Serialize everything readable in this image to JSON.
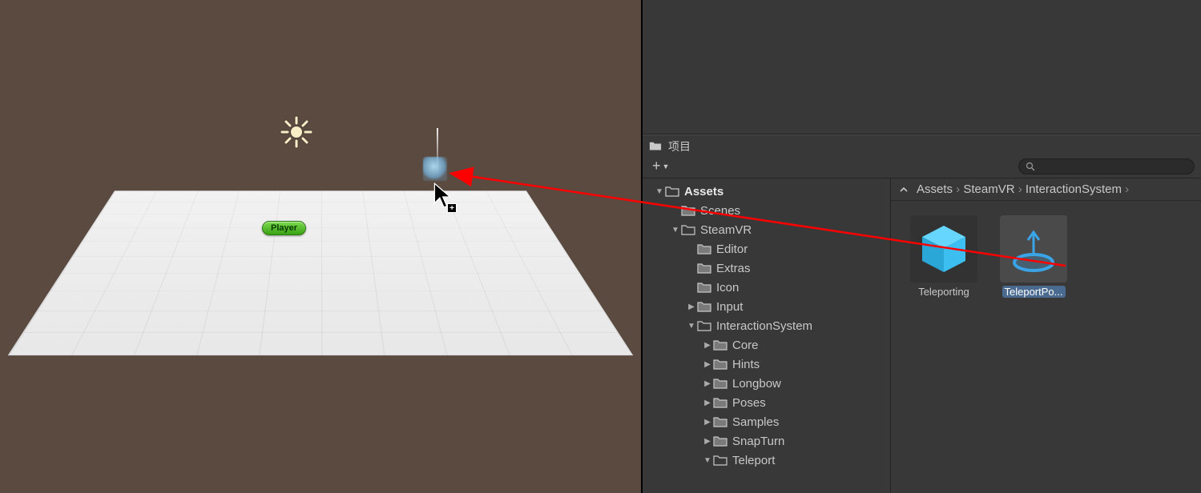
{
  "colors": {
    "panel_bg": "#383838",
    "accent_prefab": "#49c2f1",
    "player_pill": "#55c22d",
    "arrow": "#ff0000"
  },
  "scene": {
    "player_label": "Player"
  },
  "project": {
    "panel_title": "项目",
    "search_placeholder": "",
    "breadcrumb": [
      "Assets",
      "SteamVR",
      "InteractionSystem"
    ],
    "tree": {
      "root": "Assets",
      "nodes": [
        {
          "name": "Scenes",
          "depth": 1,
          "expandable": false
        },
        {
          "name": "SteamVR",
          "depth": 1,
          "expandable": true,
          "expanded": true
        },
        {
          "name": "Editor",
          "depth": 2,
          "expandable": false
        },
        {
          "name": "Extras",
          "depth": 2,
          "expandable": false
        },
        {
          "name": "Icon",
          "depth": 2,
          "expandable": false
        },
        {
          "name": "Input",
          "depth": 2,
          "expandable": true,
          "expanded": false
        },
        {
          "name": "InteractionSystem",
          "depth": 2,
          "expandable": true,
          "expanded": true
        },
        {
          "name": "Core",
          "depth": 3,
          "expandable": true,
          "expanded": false
        },
        {
          "name": "Hints",
          "depth": 3,
          "expandable": true,
          "expanded": false
        },
        {
          "name": "Longbow",
          "depth": 3,
          "expandable": true,
          "expanded": false
        },
        {
          "name": "Poses",
          "depth": 3,
          "expandable": true,
          "expanded": false
        },
        {
          "name": "Samples",
          "depth": 3,
          "expandable": true,
          "expanded": false
        },
        {
          "name": "SnapTurn",
          "depth": 3,
          "expandable": true,
          "expanded": false
        },
        {
          "name": "Teleport",
          "depth": 3,
          "expandable": true,
          "expanded": true
        }
      ]
    },
    "assets": [
      {
        "name": "Teleporting",
        "icon": "prefab-cube",
        "selected": false
      },
      {
        "name": "TeleportPo...",
        "icon": "teleport-point",
        "selected": true
      }
    ]
  }
}
